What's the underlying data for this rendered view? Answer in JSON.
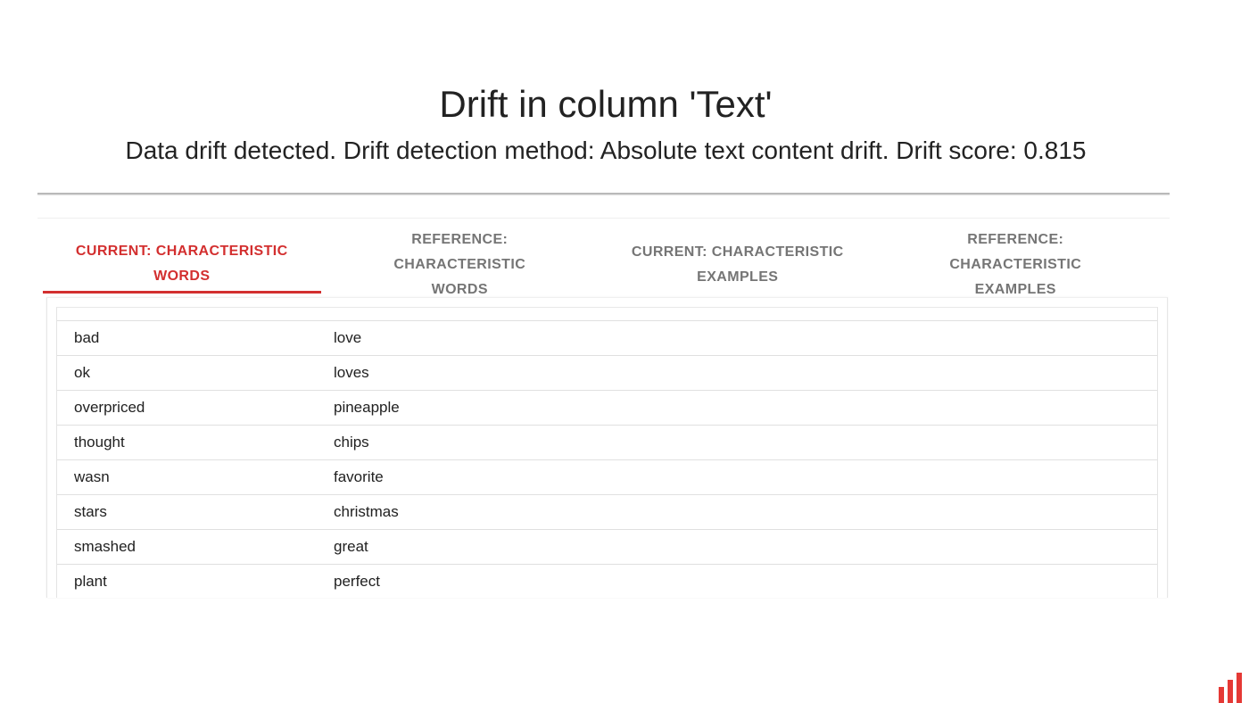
{
  "header": {
    "title": "Drift in column 'Text'",
    "subtitle": "Data drift detected. Drift detection method: Absolute text content drift. Drift score: 0.815"
  },
  "tabs": [
    {
      "line1": "CURRENT: CHARACTERISTIC",
      "line2": "WORDS",
      "active": true
    },
    {
      "line1": "REFERENCE: CHARACTERISTIC",
      "line2": "WORDS",
      "active": false
    },
    {
      "line1": "CURRENT: CHARACTERISTIC",
      "line2": "EXAMPLES",
      "active": false
    },
    {
      "line1": "REFERENCE: CHARACTERISTIC",
      "line2": "EXAMPLES",
      "active": false
    }
  ],
  "table": {
    "rows": [
      [
        "bad",
        "love"
      ],
      [
        "ok",
        "loves"
      ],
      [
        "overpriced",
        "pineapple"
      ],
      [
        "thought",
        "chips"
      ],
      [
        "wasn",
        "favorite"
      ],
      [
        "stars",
        "christmas"
      ],
      [
        "smashed",
        "great"
      ],
      [
        "plant",
        "perfect"
      ]
    ]
  },
  "colors": {
    "accent": "#d32f2f",
    "tab_inactive": "#757575",
    "logo": "#e53935"
  },
  "icons": {
    "logo": "bar-chart-logo-icon"
  }
}
